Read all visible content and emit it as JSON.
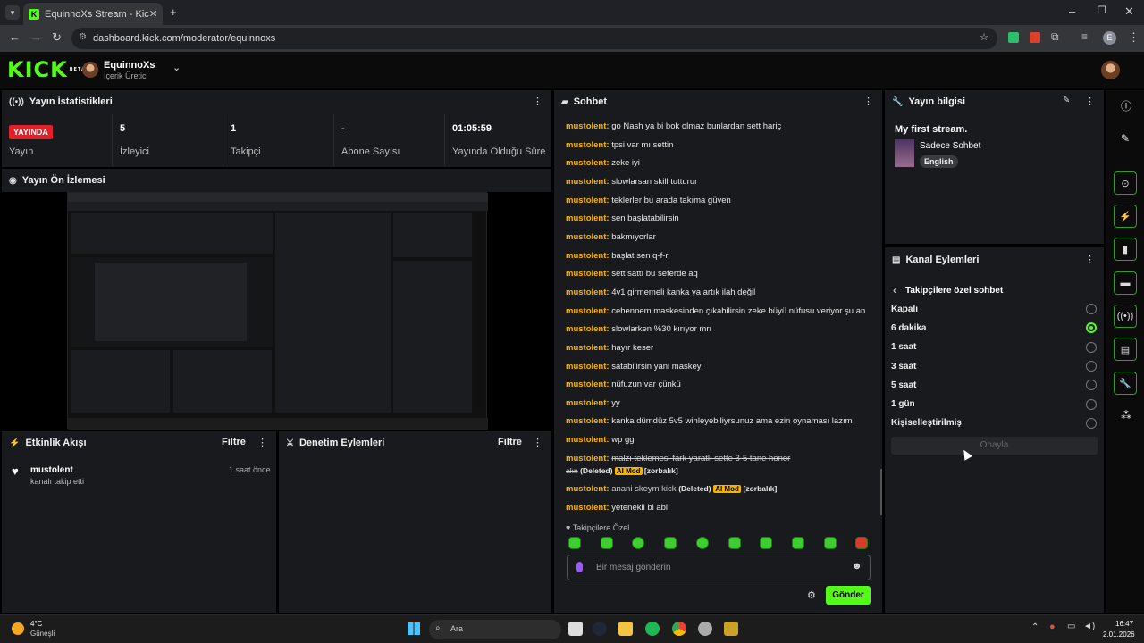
{
  "browser": {
    "tab_title": "EquinnoXs Stream - Kick Dashb",
    "url": "dashboard.kick.com/moderator/equinnoxs",
    "profile_initial": "E"
  },
  "header": {
    "logo": "KICK",
    "logo_sup": "BETA",
    "channel": "EquinnoXs",
    "role": "İçerik Üretici"
  },
  "stats": {
    "title": "Yayın İstatistikleri",
    "live_badge": "YAYINDA",
    "items": [
      {
        "value": "",
        "label": "Yayın"
      },
      {
        "value": "5",
        "label": "İzleyici"
      },
      {
        "value": "1",
        "label": "Takipçi"
      },
      {
        "value": "-",
        "label": "Abone Sayısı"
      },
      {
        "value": "01:05:59",
        "label": "Yayında Olduğu Süre"
      }
    ]
  },
  "preview": {
    "title": "Yayın Ön İzlemesi"
  },
  "activity": {
    "title": "Etkinlik Akışı",
    "filter": "Filtre",
    "item": {
      "user": "mustolent",
      "time": "1 saat önce",
      "text": "kanalı takip etti"
    }
  },
  "moderation": {
    "title": "Denetim Eylemleri",
    "filter": "Filtre"
  },
  "chat": {
    "title": "Sohbet",
    "messages": [
      {
        "user": "mustolent:",
        "text": "go Nash ya bi bok olmaz bunlardan sett hariç"
      },
      {
        "user": "mustolent:",
        "text": "tpsi var mı settin"
      },
      {
        "user": "mustolent:",
        "text": "zeke iyi"
      },
      {
        "user": "mustolent:",
        "text": "slowlarsan skill tutturur"
      },
      {
        "user": "mustolent:",
        "text": "teklerler bu arada takıma güven"
      },
      {
        "user": "mustolent:",
        "text": "sen başlatabilirsin"
      },
      {
        "user": "mustolent:",
        "text": "bakmıyorlar"
      },
      {
        "user": "mustolent:",
        "text": "başlat sen q-f-r"
      },
      {
        "user": "mustolent:",
        "text": "sett sattı bu seferde aq"
      },
      {
        "user": "mustolent:",
        "text": "4v1 girmemeli kanka ya artık ilah değil"
      },
      {
        "user": "mustolent:",
        "text": "cehennem maskesinden çıkabilirsin zeke büyü nüfusu veriyor şu an"
      },
      {
        "user": "mustolent:",
        "text": "slowlarken %30 kırıyor mrı"
      },
      {
        "user": "mustolent:",
        "text": "hayır keser"
      },
      {
        "user": "mustolent:",
        "text": "satabilirsin yani maskeyi"
      },
      {
        "user": "mustolent:",
        "text": "nüfuzun var çünkü"
      },
      {
        "user": "mustolent:",
        "text": "yy"
      },
      {
        "user": "mustolent:",
        "text": "kanka dümdüz 5v5 winleyebiliyrsunuz ama ezin oynaması lazım"
      },
      {
        "user": "mustolent:",
        "text": "wp gg"
      }
    ],
    "deleted1": {
      "user": "mustolent:",
      "text": "malzı teklemesi fark yaratlı sette 3-5 tane honor",
      "text2": "alın",
      "deleted": "(Deleted)",
      "ai": "AI Mod",
      "reason": "[zorbalık]"
    },
    "deleted2": {
      "user": "mustolent:",
      "text": "anani skeym kick",
      "deleted": "(Deleted)",
      "ai": "AI Mod",
      "reason": "[zorbalık]"
    },
    "last": {
      "user": "mustolent:",
      "text": "yetenekli bi abi"
    },
    "followers_only": "Takipçilere Özel",
    "input_placeholder": "Bir mesaj gönderin",
    "send": "Gönder"
  },
  "info": {
    "title": "Yayın bilgisi",
    "stream_title": "My first stream.",
    "category": "Sadece Sohbet",
    "language": "English"
  },
  "actions": {
    "title": "Kanal Eylemleri",
    "subtitle": "Takipçilere özel sohbet",
    "options": [
      "Kapalı",
      "6 dakika",
      "1 saat",
      "3 saat",
      "5 saat",
      "1 gün",
      "Kişiselleştirilmiş"
    ],
    "selected": 1,
    "confirm": "Onayla"
  },
  "taskbar": {
    "temp": "4°C",
    "weather": "Güneşli",
    "search": "Ara",
    "time": "16:47",
    "date": "2.01.2026"
  }
}
